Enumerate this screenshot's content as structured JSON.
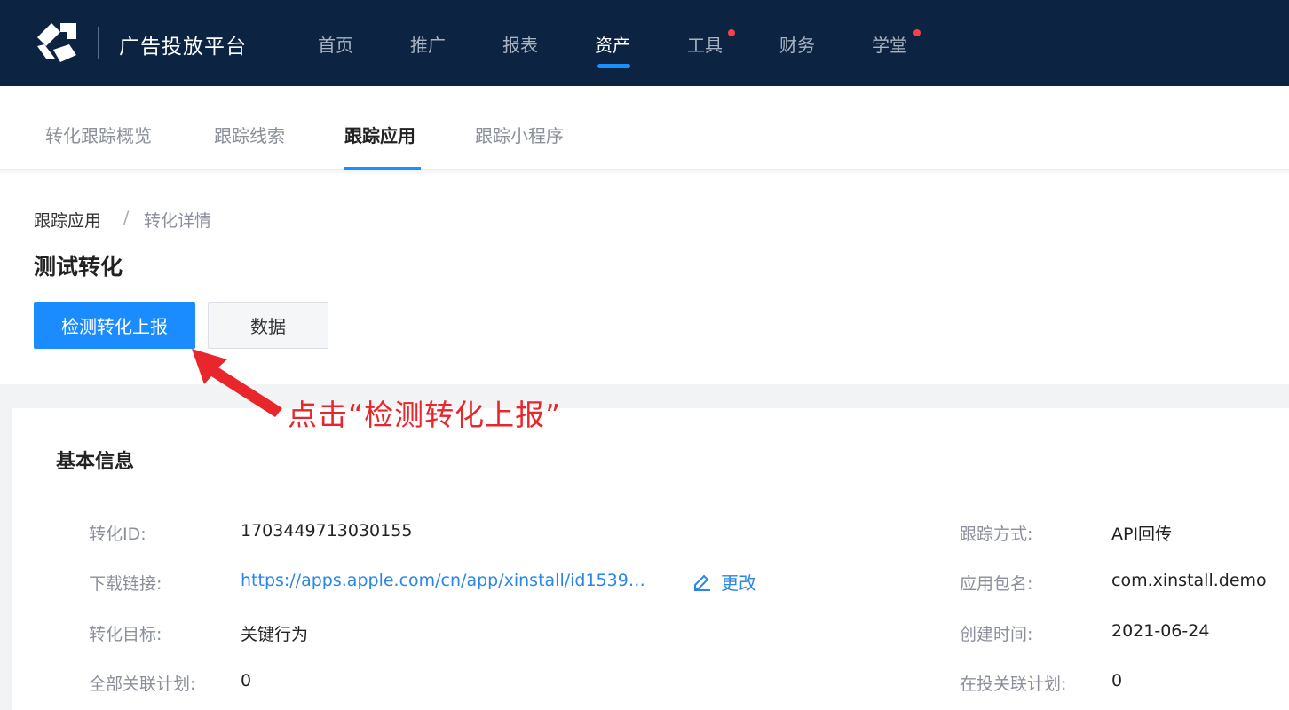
{
  "header": {
    "brand": "广告投放平台",
    "nav": [
      {
        "label": "首页",
        "active": false,
        "dot": false
      },
      {
        "label": "推广",
        "active": false,
        "dot": false
      },
      {
        "label": "报表",
        "active": false,
        "dot": false
      },
      {
        "label": "资产",
        "active": true,
        "dot": false
      },
      {
        "label": "工具",
        "active": false,
        "dot": true
      },
      {
        "label": "财务",
        "active": false,
        "dot": false
      },
      {
        "label": "学堂",
        "active": false,
        "dot": true
      }
    ]
  },
  "subtabs": [
    {
      "label": "转化跟踪概览",
      "active": false
    },
    {
      "label": "跟踪线索",
      "active": false
    },
    {
      "label": "跟踪应用",
      "active": true
    },
    {
      "label": "跟踪小程序",
      "active": false
    }
  ],
  "breadcrumb": {
    "parent": "跟踪应用",
    "separator": "/",
    "current": "转化详情"
  },
  "page_title": "测试转化",
  "buttons": {
    "primary": "检测转化上报",
    "secondary": "数据"
  },
  "annotation": "点击“检测转化上报”",
  "card": {
    "title": "基本信息",
    "left": [
      {
        "label": "转化ID:",
        "value": "1703449713030155"
      },
      {
        "label": "下载链接:",
        "value": "https://apps.apple.com/cn/app/xinstall/id1539…",
        "edit": "更改"
      },
      {
        "label": "转化目标:",
        "value": "关键行为"
      },
      {
        "label": "全部关联计划:",
        "value": "0"
      }
    ],
    "right": [
      {
        "label": "跟踪方式:",
        "value": "API回传"
      },
      {
        "label": "应用包名:",
        "value": "com.xinstall.demo"
      },
      {
        "label": "创建时间:",
        "value": "2021-06-24"
      },
      {
        "label": "在投关联计划:",
        "value": "0"
      }
    ]
  },
  "colors": {
    "nav_bg": "#0c2341",
    "accent": "#1a8cff",
    "annotation": "#e8262b",
    "link": "#2a87e6"
  },
  "icons": [
    "logo-icon",
    "pencil-icon",
    "arrow-annotation"
  ]
}
